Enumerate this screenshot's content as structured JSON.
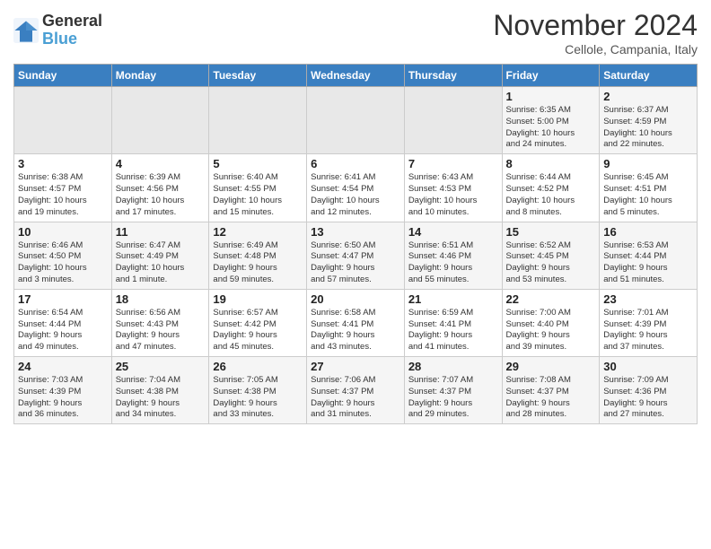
{
  "logo": {
    "line1": "General",
    "line2": "Blue"
  },
  "title": "November 2024",
  "subtitle": "Cellole, Campania, Italy",
  "weekdays": [
    "Sunday",
    "Monday",
    "Tuesday",
    "Wednesday",
    "Thursday",
    "Friday",
    "Saturday"
  ],
  "weeks": [
    [
      {
        "day": "",
        "data": ""
      },
      {
        "day": "",
        "data": ""
      },
      {
        "day": "",
        "data": ""
      },
      {
        "day": "",
        "data": ""
      },
      {
        "day": "",
        "data": ""
      },
      {
        "day": "1",
        "data": "Sunrise: 6:35 AM\nSunset: 5:00 PM\nDaylight: 10 hours\nand 24 minutes."
      },
      {
        "day": "2",
        "data": "Sunrise: 6:37 AM\nSunset: 4:59 PM\nDaylight: 10 hours\nand 22 minutes."
      }
    ],
    [
      {
        "day": "3",
        "data": "Sunrise: 6:38 AM\nSunset: 4:57 PM\nDaylight: 10 hours\nand 19 minutes."
      },
      {
        "day": "4",
        "data": "Sunrise: 6:39 AM\nSunset: 4:56 PM\nDaylight: 10 hours\nand 17 minutes."
      },
      {
        "day": "5",
        "data": "Sunrise: 6:40 AM\nSunset: 4:55 PM\nDaylight: 10 hours\nand 15 minutes."
      },
      {
        "day": "6",
        "data": "Sunrise: 6:41 AM\nSunset: 4:54 PM\nDaylight: 10 hours\nand 12 minutes."
      },
      {
        "day": "7",
        "data": "Sunrise: 6:43 AM\nSunset: 4:53 PM\nDaylight: 10 hours\nand 10 minutes."
      },
      {
        "day": "8",
        "data": "Sunrise: 6:44 AM\nSunset: 4:52 PM\nDaylight: 10 hours\nand 8 minutes."
      },
      {
        "day": "9",
        "data": "Sunrise: 6:45 AM\nSunset: 4:51 PM\nDaylight: 10 hours\nand 5 minutes."
      }
    ],
    [
      {
        "day": "10",
        "data": "Sunrise: 6:46 AM\nSunset: 4:50 PM\nDaylight: 10 hours\nand 3 minutes."
      },
      {
        "day": "11",
        "data": "Sunrise: 6:47 AM\nSunset: 4:49 PM\nDaylight: 10 hours\nand 1 minute."
      },
      {
        "day": "12",
        "data": "Sunrise: 6:49 AM\nSunset: 4:48 PM\nDaylight: 9 hours\nand 59 minutes."
      },
      {
        "day": "13",
        "data": "Sunrise: 6:50 AM\nSunset: 4:47 PM\nDaylight: 9 hours\nand 57 minutes."
      },
      {
        "day": "14",
        "data": "Sunrise: 6:51 AM\nSunset: 4:46 PM\nDaylight: 9 hours\nand 55 minutes."
      },
      {
        "day": "15",
        "data": "Sunrise: 6:52 AM\nSunset: 4:45 PM\nDaylight: 9 hours\nand 53 minutes."
      },
      {
        "day": "16",
        "data": "Sunrise: 6:53 AM\nSunset: 4:44 PM\nDaylight: 9 hours\nand 51 minutes."
      }
    ],
    [
      {
        "day": "17",
        "data": "Sunrise: 6:54 AM\nSunset: 4:44 PM\nDaylight: 9 hours\nand 49 minutes."
      },
      {
        "day": "18",
        "data": "Sunrise: 6:56 AM\nSunset: 4:43 PM\nDaylight: 9 hours\nand 47 minutes."
      },
      {
        "day": "19",
        "data": "Sunrise: 6:57 AM\nSunset: 4:42 PM\nDaylight: 9 hours\nand 45 minutes."
      },
      {
        "day": "20",
        "data": "Sunrise: 6:58 AM\nSunset: 4:41 PM\nDaylight: 9 hours\nand 43 minutes."
      },
      {
        "day": "21",
        "data": "Sunrise: 6:59 AM\nSunset: 4:41 PM\nDaylight: 9 hours\nand 41 minutes."
      },
      {
        "day": "22",
        "data": "Sunrise: 7:00 AM\nSunset: 4:40 PM\nDaylight: 9 hours\nand 39 minutes."
      },
      {
        "day": "23",
        "data": "Sunrise: 7:01 AM\nSunset: 4:39 PM\nDaylight: 9 hours\nand 37 minutes."
      }
    ],
    [
      {
        "day": "24",
        "data": "Sunrise: 7:03 AM\nSunset: 4:39 PM\nDaylight: 9 hours\nand 36 minutes."
      },
      {
        "day": "25",
        "data": "Sunrise: 7:04 AM\nSunset: 4:38 PM\nDaylight: 9 hours\nand 34 minutes."
      },
      {
        "day": "26",
        "data": "Sunrise: 7:05 AM\nSunset: 4:38 PM\nDaylight: 9 hours\nand 33 minutes."
      },
      {
        "day": "27",
        "data": "Sunrise: 7:06 AM\nSunset: 4:37 PM\nDaylight: 9 hours\nand 31 minutes."
      },
      {
        "day": "28",
        "data": "Sunrise: 7:07 AM\nSunset: 4:37 PM\nDaylight: 9 hours\nand 29 minutes."
      },
      {
        "day": "29",
        "data": "Sunrise: 7:08 AM\nSunset: 4:37 PM\nDaylight: 9 hours\nand 28 minutes."
      },
      {
        "day": "30",
        "data": "Sunrise: 7:09 AM\nSunset: 4:36 PM\nDaylight: 9 hours\nand 27 minutes."
      }
    ]
  ]
}
